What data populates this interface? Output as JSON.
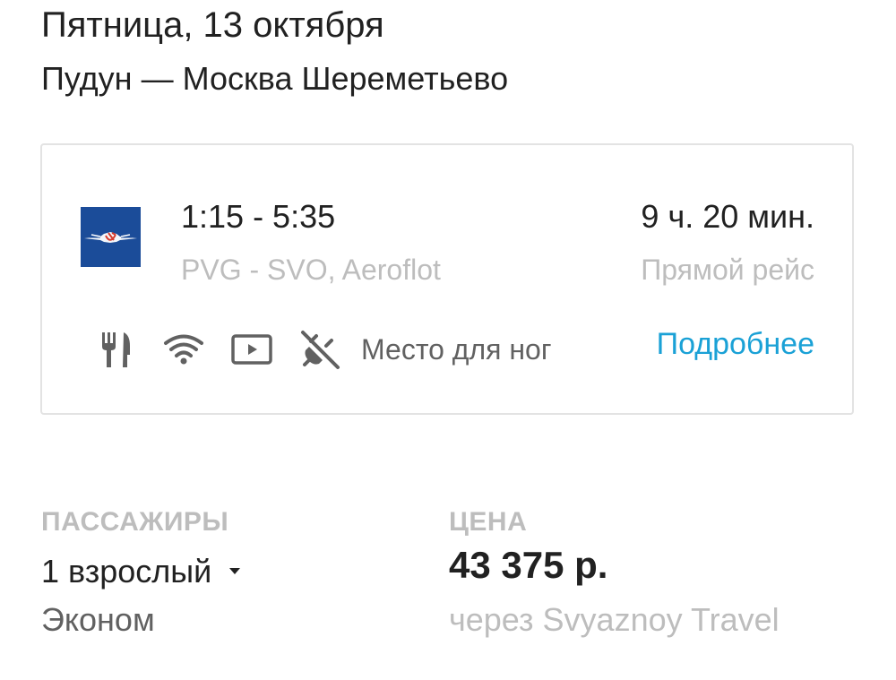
{
  "header": {
    "date": "Пятница, 13 октября",
    "route": "Пудун — Москва Шереметьево"
  },
  "flight": {
    "airline_logo": "aeroflot-logo",
    "logo_color": "#1b4c99",
    "times": "1:15 - 5:35",
    "airports_airline": "PVG - SVO, Aeroflot",
    "duration": "9 ч. 20 мин.",
    "flight_type": "Прямой рейс",
    "amenities": {
      "icons": [
        "food-icon",
        "wifi-icon",
        "video-icon",
        "no-power-icon"
      ],
      "legroom_label": "Место для ног"
    },
    "details_link": "Подробнее",
    "link_color": "#1aa1d6"
  },
  "passengers": {
    "label": "ПАССАЖИРЫ",
    "selected": "1 взрослый",
    "dropdown_icon": "dropdown-arrow-icon",
    "cabin_class": "Эконом"
  },
  "price": {
    "label": "ЦЕНА",
    "value": "43 375 р.",
    "provider": "через Svyaznoy Travel"
  }
}
